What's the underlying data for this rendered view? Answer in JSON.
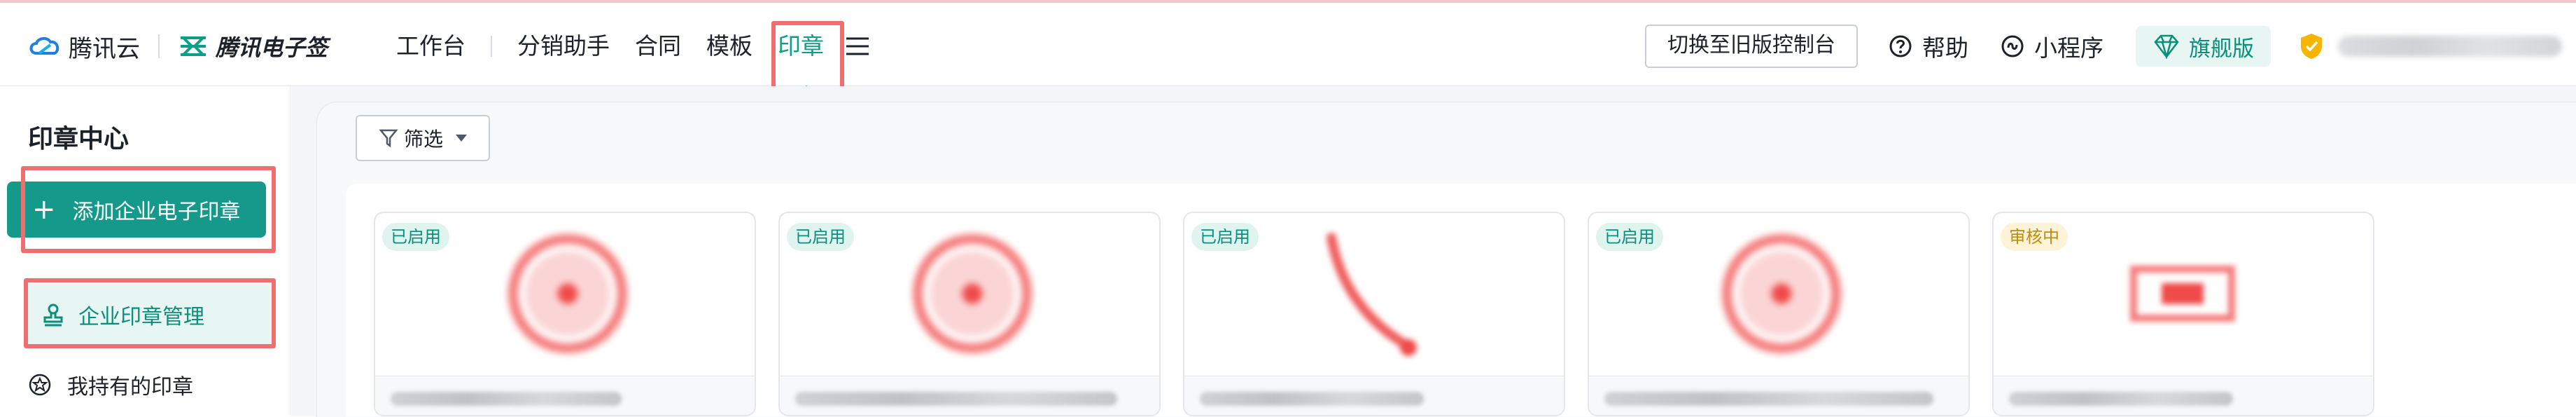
{
  "header": {
    "brand_primary": "腾讯云",
    "brand_secondary": "腾讯电子签",
    "nav": [
      {
        "label": "工作台"
      },
      {
        "label": "分销助手"
      },
      {
        "label": "合同"
      },
      {
        "label": "模板"
      },
      {
        "label": "印章",
        "active": true
      }
    ],
    "switch_button": "切换至旧版控制台",
    "help": "帮助",
    "mini_program": "小程序",
    "edition_badge": "旗舰版"
  },
  "sidebar": {
    "title": "印章中心",
    "add_button": "添加企业电子印章",
    "items": [
      {
        "label": "企业印章管理",
        "active": true,
        "icon": "stamp-icon"
      },
      {
        "label": "我持有的印章",
        "active": false,
        "icon": "seal-circle-icon"
      }
    ]
  },
  "toolbar": {
    "filter_label": "筛选"
  },
  "cards": [
    {
      "status": "已启用",
      "status_type": "enabled"
    },
    {
      "status": "已启用",
      "status_type": "enabled"
    },
    {
      "status": "已启用",
      "status_type": "enabled"
    },
    {
      "status": "已启用",
      "status_type": "enabled"
    },
    {
      "status": "审核中",
      "status_type": "review"
    }
  ],
  "colors": {
    "accent": "#15998a",
    "active_text": "#0a9f86",
    "highlight_box": "#ef6f6f",
    "seal_red": "#f04a4a"
  }
}
